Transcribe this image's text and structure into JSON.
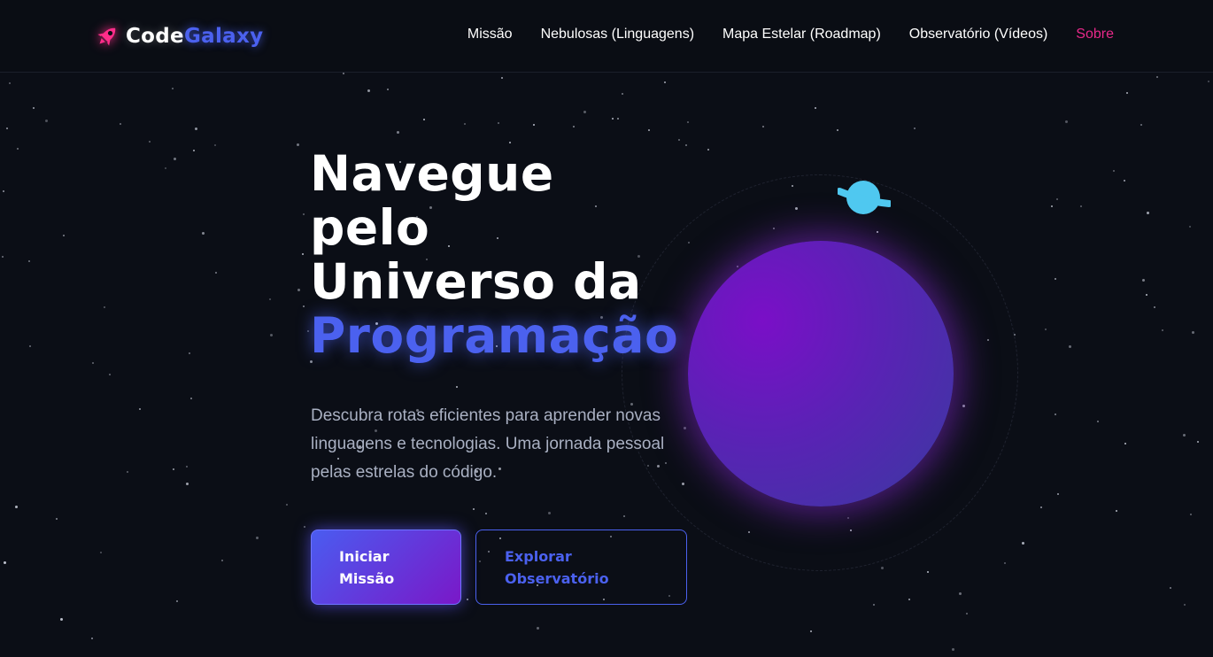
{
  "navbar": {
    "logo": {
      "part1": "Code",
      "part2": "Galaxy",
      "icon": "rocket-icon"
    },
    "links": [
      {
        "label": "Missão",
        "active": false
      },
      {
        "label": "Nebulosas (Linguagens)",
        "active": false
      },
      {
        "label": "Mapa Estelar (Roadmap)",
        "active": false
      },
      {
        "label": "Observatório (Vídeos)",
        "active": false
      },
      {
        "label": "Sobre",
        "active": true
      }
    ]
  },
  "hero": {
    "title_lines": [
      "Navegue",
      "pelo",
      "Universo da"
    ],
    "title_accent": "Programação",
    "description": "Descubra rotas eficientes para aprender novas linguagens e tecnologias. Uma jornada pessoal pelas estrelas do código.",
    "primary_button": {
      "line1": "Iniciar",
      "line2": "Missão"
    },
    "secondary_button": {
      "line1": "Explorar",
      "line2": "Observatório"
    }
  },
  "colors": {
    "background": "#0b0e16",
    "accent_blue": "#4b61ef",
    "accent_pink": "#e8288a",
    "planet_purple": "#7a0fc7",
    "moon_cyan": "#4fc8f0"
  }
}
